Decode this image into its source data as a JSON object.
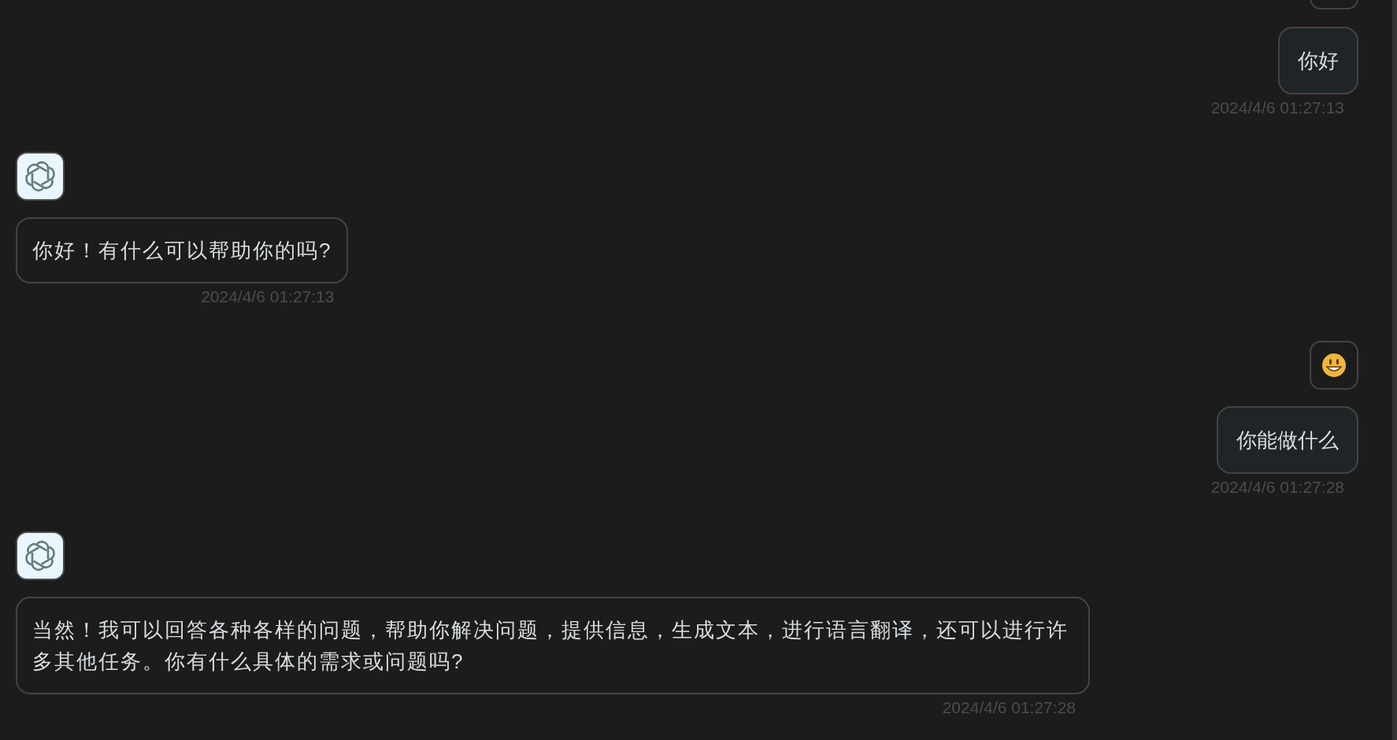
{
  "scrolled_off_avatar": true,
  "messages": [
    {
      "kind": "user",
      "text": "你好",
      "time": "2024/4/6 01:27:13"
    },
    {
      "kind": "assistant",
      "text": "你好！有什么可以帮助你的吗?",
      "time": "2024/4/6 01:27:13"
    },
    {
      "kind": "user",
      "text": "你能做什么",
      "time": "2024/4/6 01:27:28"
    },
    {
      "kind": "assistant",
      "text": "当然！我可以回答各种各样的问题，帮助你解决问题，提供信息，生成文本，进行语言翻译，还可以进行许多其他任务。你有什么具体的需求或问题吗?",
      "time": "2024/4/6 01:27:28"
    }
  ]
}
